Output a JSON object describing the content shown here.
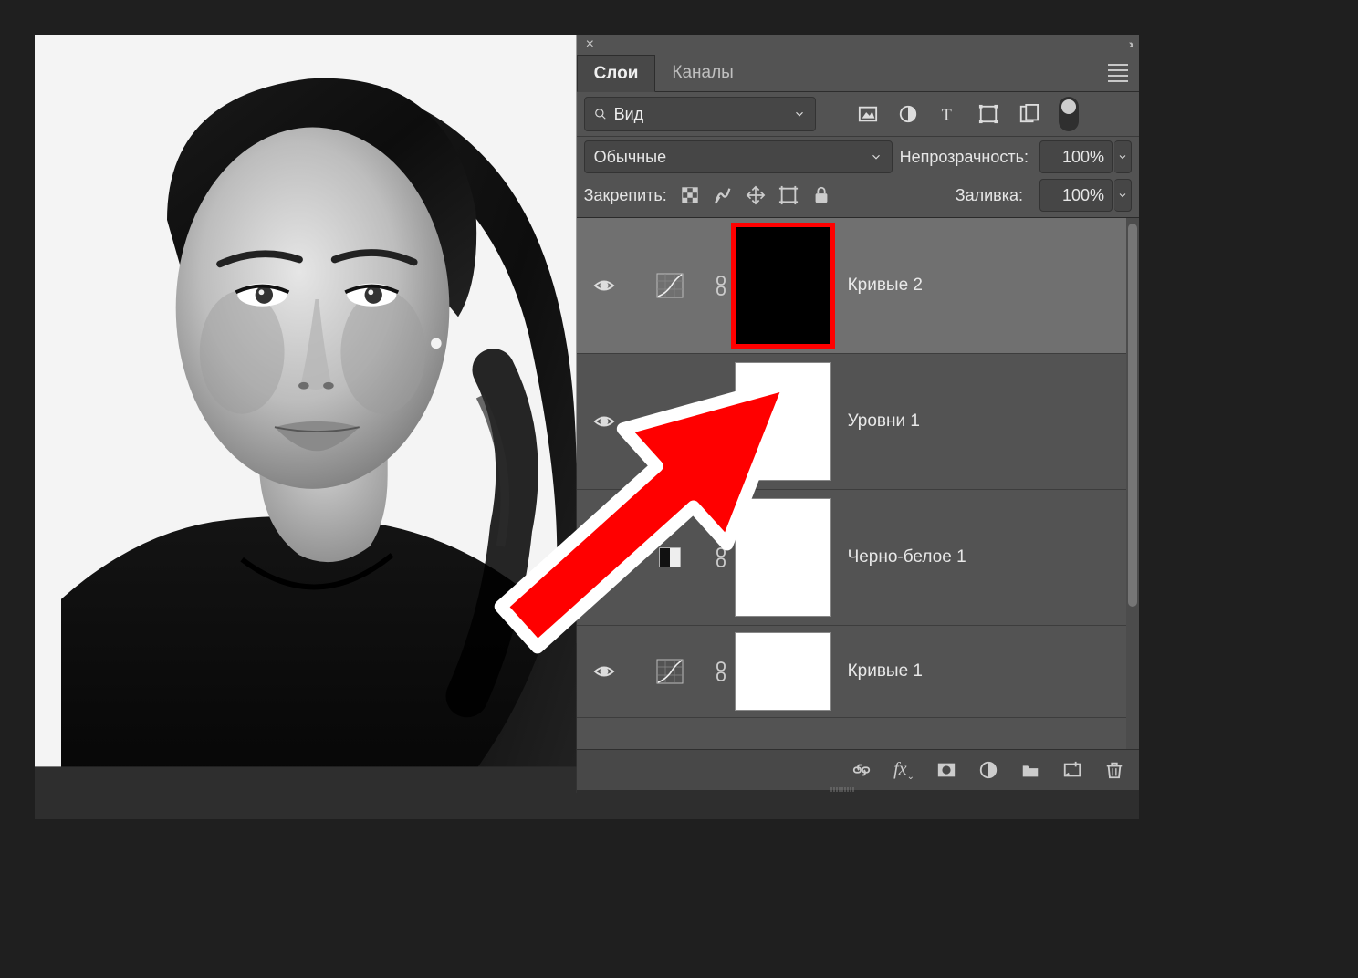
{
  "panel": {
    "tabs": {
      "layers": "Слои",
      "channels": "Каналы"
    },
    "filter": {
      "kind_label": "Вид"
    },
    "filter_icons": {
      "image": "image-icon",
      "adjustment": "adjustment-icon",
      "type": "type-icon",
      "shape": "shape-icon",
      "smart": "smart-object-icon"
    },
    "blend": {
      "mode": "Обычные",
      "opacity_label": "Непрозрачность:",
      "opacity_value": "100%"
    },
    "lock": {
      "label": "Закрепить:",
      "fill_label": "Заливка:",
      "fill_value": "100%"
    },
    "layers": [
      {
        "name": "Кривые 2",
        "type": "curves",
        "mask": "black",
        "selected": true,
        "visible": true
      },
      {
        "name": "Уровни 1",
        "type": "levels",
        "mask": "white",
        "selected": false,
        "visible": true
      },
      {
        "name": "Черно-белое 1",
        "type": "bw",
        "mask": "white",
        "selected": false,
        "visible": true
      },
      {
        "name": "Кривые 1",
        "type": "curves",
        "mask": "white_partial",
        "selected": false,
        "visible": true
      }
    ],
    "footer_icons": {
      "link": "link-layers-icon",
      "fx": "fx-icon",
      "mask": "add-mask-icon",
      "adjustment": "adjustment-layer-icon",
      "group": "group-icon",
      "new": "new-layer-icon",
      "delete": "delete-icon"
    }
  }
}
